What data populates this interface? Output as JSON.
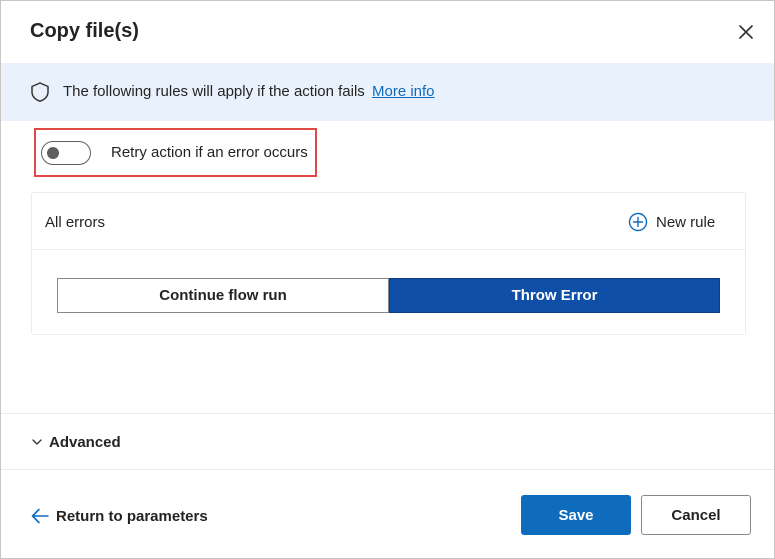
{
  "dialog": {
    "title": "Copy file(s)"
  },
  "info": {
    "text": "The following rules will apply if the action fails",
    "link": "More info"
  },
  "retry": {
    "label": "Retry action if an error occurs",
    "enabled": false
  },
  "rules": {
    "scope_label": "All errors",
    "new_rule_label": "New rule",
    "options": [
      "Continue flow run",
      "Throw Error"
    ],
    "selected": "Throw Error"
  },
  "advanced": {
    "label": "Advanced",
    "expanded": false
  },
  "footer": {
    "return_label": "Return to parameters",
    "save_label": "Save",
    "cancel_label": "Cancel"
  },
  "colors": {
    "accent": "#0f6cbd",
    "selected_segment": "#0f4fa8",
    "info_bar": "#e9f2fc",
    "highlight_border": "#e04848"
  }
}
